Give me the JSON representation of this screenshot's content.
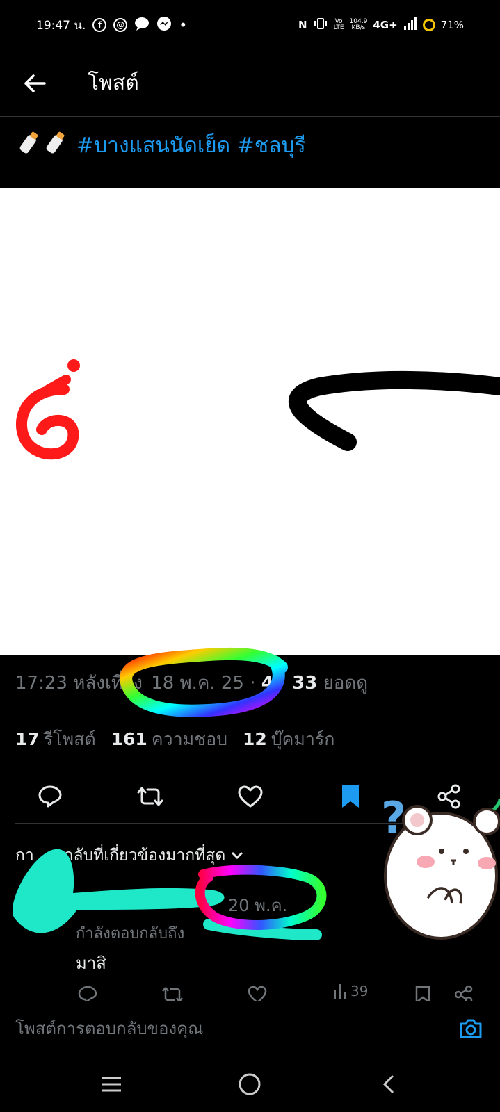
{
  "status_bar": {
    "time": "19:47 น.",
    "speed": "104.9",
    "speed_unit": "KB/s",
    "network": "4G+",
    "battery": "71%"
  },
  "header": {
    "title": "โพสต์"
  },
  "post": {
    "hashtags": "#บางแสนนัดเย็ด #ชลบุรี",
    "time_meta": "17:23 หลังเที่ยง",
    "date": "18 พ.ค. 25",
    "views_prefix": "4",
    "views_suffix": "33",
    "views_label": "ยอดดู",
    "reposts_count": "17",
    "reposts_label": "รีโพสต์",
    "likes_count": "161",
    "likes_label": "ความชอบ",
    "bookmarks_count": "12",
    "bookmarks_label": "บุ๊คมาร์ก"
  },
  "replies": {
    "sort_label_a": "กา",
    "sort_label_b": "บกลับที่เกี่ยวข้องมากที่สุด",
    "reply_date": "20 พ.ค.",
    "replying_to": "กำลังตอบกลับถึง",
    "reply_text": "มาสิ",
    "reply_views": "39"
  },
  "compose": {
    "placeholder": "โพสต์การตอบกลับของคุณ"
  },
  "stickers": {
    "question_mark": "?"
  },
  "colors": {
    "accent": "#1d9bf0",
    "muted": "#71767b",
    "background": "#000000",
    "scribble_cyan": "#1ee8c8"
  }
}
